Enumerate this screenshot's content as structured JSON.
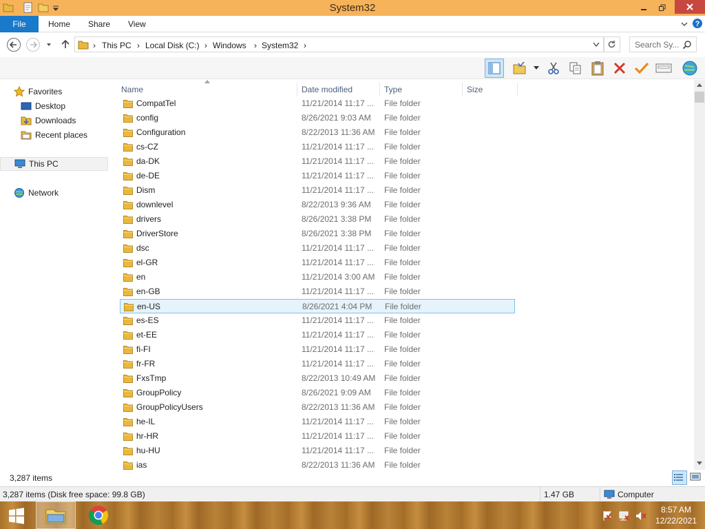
{
  "window": {
    "title": "System32"
  },
  "ribbon": {
    "tabs": [
      "File",
      "Home",
      "Share",
      "View"
    ]
  },
  "address": {
    "crumbs": [
      "This PC",
      "Local Disk (C:)",
      "Windows",
      "System32"
    ],
    "search_placeholder": "Search Sy..."
  },
  "nav": {
    "favorites": "Favorites",
    "desktop": "Desktop",
    "downloads": "Downloads",
    "recent": "Recent places",
    "thispc": "This PC",
    "network": "Network"
  },
  "columns": {
    "name": "Name",
    "date": "Date modified",
    "type": "Type",
    "size": "Size"
  },
  "files": [
    {
      "name": "CompatTel",
      "date": "11/21/2014 11:17 ...",
      "type": "File folder"
    },
    {
      "name": "config",
      "date": "8/26/2021 9:03 AM",
      "type": "File folder"
    },
    {
      "name": "Configuration",
      "date": "8/22/2013 11:36 AM",
      "type": "File folder"
    },
    {
      "name": "cs-CZ",
      "date": "11/21/2014 11:17 ...",
      "type": "File folder"
    },
    {
      "name": "da-DK",
      "date": "11/21/2014 11:17 ...",
      "type": "File folder"
    },
    {
      "name": "de-DE",
      "date": "11/21/2014 11:17 ...",
      "type": "File folder"
    },
    {
      "name": "Dism",
      "date": "11/21/2014 11:17 ...",
      "type": "File folder"
    },
    {
      "name": "downlevel",
      "date": "8/22/2013 9:36 AM",
      "type": "File folder"
    },
    {
      "name": "drivers",
      "date": "8/26/2021 3:38 PM",
      "type": "File folder"
    },
    {
      "name": "DriverStore",
      "date": "8/26/2021 3:38 PM",
      "type": "File folder"
    },
    {
      "name": "dsc",
      "date": "11/21/2014 11:17 ...",
      "type": "File folder"
    },
    {
      "name": "el-GR",
      "date": "11/21/2014 11:17 ...",
      "type": "File folder"
    },
    {
      "name": "en",
      "date": "11/21/2014 3:00 AM",
      "type": "File folder"
    },
    {
      "name": "en-GB",
      "date": "11/21/2014 11:17 ...",
      "type": "File folder"
    },
    {
      "name": "en-US",
      "date": "8/26/2021 4:04 PM",
      "type": "File folder"
    },
    {
      "name": "es-ES",
      "date": "11/21/2014 11:17 ...",
      "type": "File folder"
    },
    {
      "name": "et-EE",
      "date": "11/21/2014 11:17 ...",
      "type": "File folder"
    },
    {
      "name": "fi-FI",
      "date": "11/21/2014 11:17 ...",
      "type": "File folder"
    },
    {
      "name": "fr-FR",
      "date": "11/21/2014 11:17 ...",
      "type": "File folder"
    },
    {
      "name": "FxsTmp",
      "date": "8/22/2013 10:49 AM",
      "type": "File folder"
    },
    {
      "name": "GroupPolicy",
      "date": "8/26/2021 9:09 AM",
      "type": "File folder"
    },
    {
      "name": "GroupPolicyUsers",
      "date": "8/22/2013 11:36 AM",
      "type": "File folder"
    },
    {
      "name": "he-IL",
      "date": "11/21/2014 11:17 ...",
      "type": "File folder"
    },
    {
      "name": "hr-HR",
      "date": "11/21/2014 11:17 ...",
      "type": "File folder"
    },
    {
      "name": "hu-HU",
      "date": "11/21/2014 11:17 ...",
      "type": "File folder"
    },
    {
      "name": "ias",
      "date": "8/22/2013 11:36 AM",
      "type": "File folder"
    }
  ],
  "selected_file": "en-US",
  "status": {
    "items": "3,287 items",
    "detail": "3,287 items (Disk free space: 99.8 GB)",
    "size": "1.47 GB",
    "location": "Computer"
  },
  "clock": {
    "time": "8:57 AM",
    "date": "12/22/2021"
  },
  "colors": {
    "titlebar": "#f7b35a",
    "file_tab": "#1979ca",
    "close": "#c7483f",
    "selection": "#e5f3fb"
  }
}
